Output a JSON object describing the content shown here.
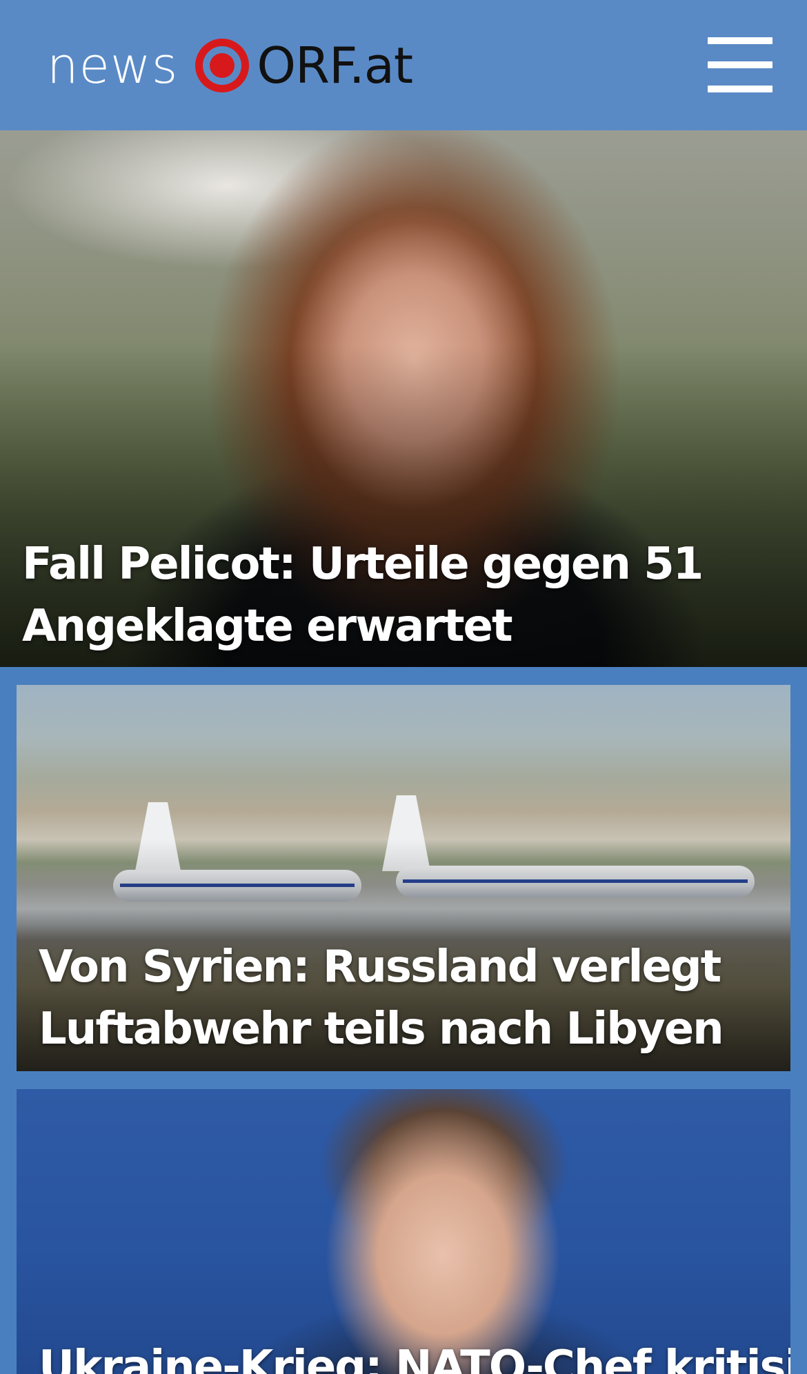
{
  "header": {
    "logo": {
      "word_news": "news",
      "word_orf": "ORF.at",
      "mark_icon": "orf-eye-logo-icon"
    },
    "menu_icon": "hamburger-menu-icon"
  },
  "stories": [
    {
      "headline_line1": "Fall Pelicot: Urteile gegen 51",
      "headline_line2": "Angeklagte erwartet"
    },
    {
      "headline_line1": "Von Syrien: Russland verlegt",
      "headline_line2": "Luftabwehr teils nach Libyen"
    },
    {
      "headline_line1": "Ukraine-Krieg: NATO-Chef kritisiert"
    }
  ],
  "colors": {
    "header_bg": "#5a8ac6",
    "page_bg": "#4a7fbf",
    "logo_red": "#d7191c"
  }
}
